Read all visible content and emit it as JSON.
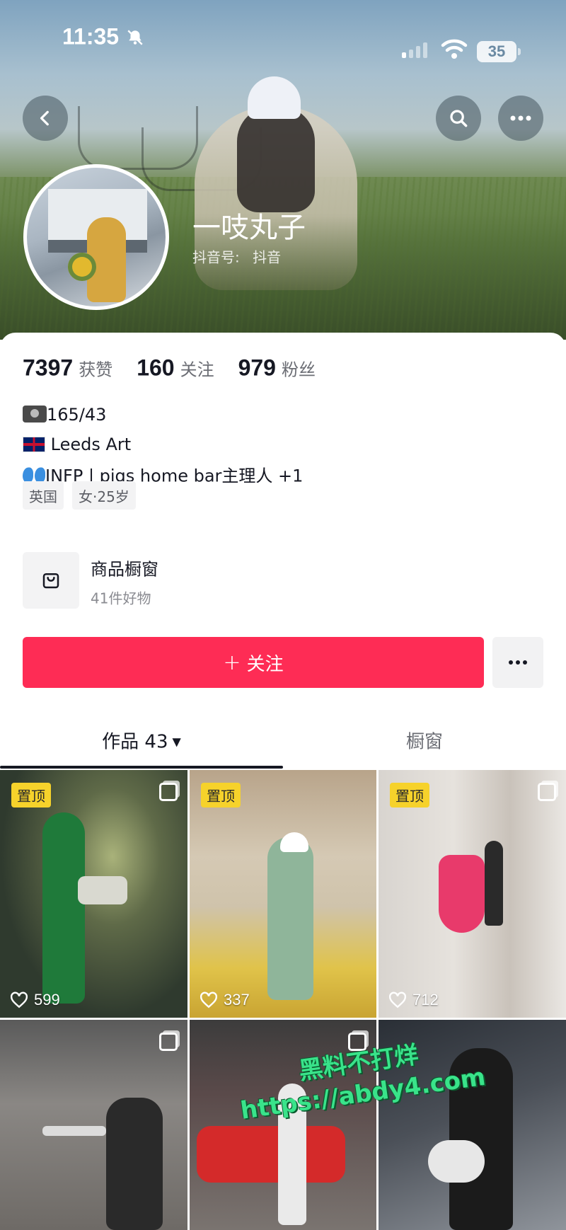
{
  "status_bar": {
    "time": "11:35",
    "battery": "35"
  },
  "profile": {
    "nickname": "一吱丸子",
    "id_label": "抖音号:",
    "id_value": "抖音"
  },
  "stats": [
    {
      "value": "7397",
      "label": "获赞"
    },
    {
      "value": "160",
      "label": "关注"
    },
    {
      "value": "979",
      "label": "粉丝"
    }
  ],
  "bio": {
    "line1": "165/43",
    "line2": "Leeds Art",
    "line3": "INFP | pigs home bar主理人 +1"
  },
  "tags": [
    "英国",
    "女·25岁"
  ],
  "shop": {
    "title": "商品橱窗",
    "subtitle": "41件好物"
  },
  "actions": {
    "follow_plus": "+",
    "follow_label": "关注",
    "more": "···"
  },
  "tabs": {
    "works": "作品 43",
    "window": "橱窗"
  },
  "posts": [
    {
      "pinned": true,
      "pin_label": "置顶",
      "likes": "599"
    },
    {
      "pinned": true,
      "pin_label": "置顶",
      "likes": "337"
    },
    {
      "pinned": true,
      "pin_label": "置顶",
      "likes": "712"
    },
    {
      "pinned": false,
      "likes": ""
    },
    {
      "pinned": false,
      "likes": ""
    },
    {
      "pinned": false,
      "likes": ""
    }
  ],
  "watermark": {
    "line1": "黑料不打烊",
    "line2": "https://abdy4.com"
  },
  "colors": {
    "accent": "#fe2c55",
    "pin": "#f6d22b",
    "watermark": "#39e38a"
  },
  "icons": [
    "back-icon",
    "search-icon",
    "more-icon",
    "bell-muted-icon",
    "wifi-icon",
    "shop-bag-icon",
    "heart-icon",
    "multi-image-icon"
  ]
}
